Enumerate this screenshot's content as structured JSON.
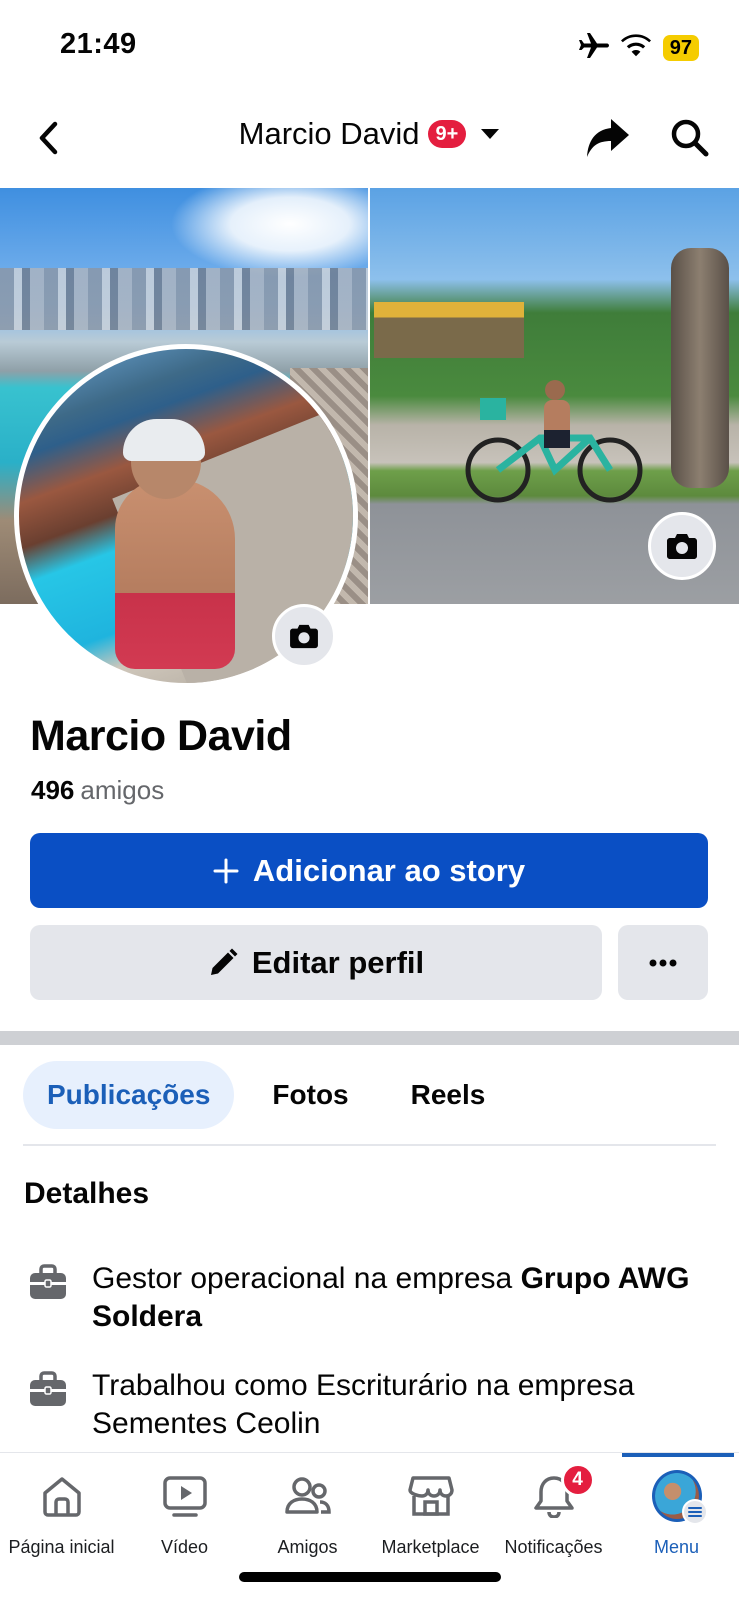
{
  "status_bar": {
    "time": "21:49",
    "battery": "97",
    "icons": [
      "airplane-icon",
      "wifi-icon",
      "battery-icon"
    ]
  },
  "header": {
    "title": "Marcio David",
    "notification_pill": "9+",
    "icons": [
      "back-chevron-icon",
      "caret-down-icon",
      "share-icon",
      "search-icon"
    ]
  },
  "profile": {
    "name": "Marcio David",
    "friends_count": "496",
    "friends_label": "amigos"
  },
  "actions": {
    "add_story_label": "Adicionar ao story",
    "edit_profile_label": "Editar perfil",
    "more_label": "···"
  },
  "tabs": [
    {
      "label": "Publicações",
      "active": true
    },
    {
      "label": "Fotos",
      "active": false
    },
    {
      "label": "Reels",
      "active": false
    }
  ],
  "details": {
    "title": "Detalhes",
    "items": [
      {
        "prefix": "Gestor operacional na empresa ",
        "bold": "Grupo AWG Soldera",
        "suffix": ""
      },
      {
        "prefix": "Trabalhou como Escriturário na empresa Sementes Ceolin",
        "bold": "",
        "suffix": ""
      }
    ]
  },
  "bottom_nav": {
    "items": [
      {
        "label": "Página inicial",
        "icon": "home-icon"
      },
      {
        "label": "Vídeo",
        "icon": "video-icon"
      },
      {
        "label": "Amigos",
        "icon": "friends-icon"
      },
      {
        "label": "Marketplace",
        "icon": "marketplace-icon"
      },
      {
        "label": "Notificações",
        "icon": "bell-icon",
        "badge": "4"
      },
      {
        "label": "Menu",
        "icon": "menu-avatar",
        "active": true
      }
    ]
  },
  "colors": {
    "primary_blue": "#0a4fc4",
    "active_tab_text": "#1b5fb8",
    "badge_red": "#e41e3f",
    "button_gray": "#e4e6eb"
  }
}
